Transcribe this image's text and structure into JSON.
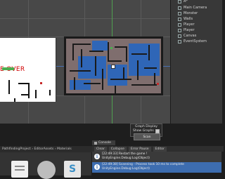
{
  "game_preview": {
    "gameover_text": "E OVER"
  },
  "hierarchy": {
    "items": [
      {
        "label": "A*"
      },
      {
        "label": "Main Camera"
      },
      {
        "label": "Monster"
      },
      {
        "label": "Walls"
      },
      {
        "label": "Player"
      },
      {
        "label": "Player"
      },
      {
        "label": "Canvas"
      },
      {
        "label": "EventSystem"
      }
    ]
  },
  "graph_display": {
    "title": "Graph Display",
    "show_graphs_label": "Show Graphs",
    "scan_label": "Scan"
  },
  "project": {
    "breadcrumb": "PathfindingProject › EditorAssets › Materials"
  },
  "console": {
    "tab_label": "Console",
    "toolbar": {
      "clear": "Clear",
      "collapse": "Collapse",
      "error_pause": "Error Pause",
      "editor": "Editor"
    },
    "logs": [
      {
        "line1": "[22:49:33] Restart the game !",
        "line2": "UnityEngine.Debug:Log(Object)"
      },
      {
        "line1": "[22:49:38] Scanning - Process took 10 ms to complete",
        "line2": "UnityEngine.Debug:Log(Object)"
      }
    ]
  },
  "colors": {
    "maze_floor": "#7f6e6e",
    "water": "#2f66b7",
    "log_selected": "#3d6db0",
    "gameover": "#d00000"
  }
}
